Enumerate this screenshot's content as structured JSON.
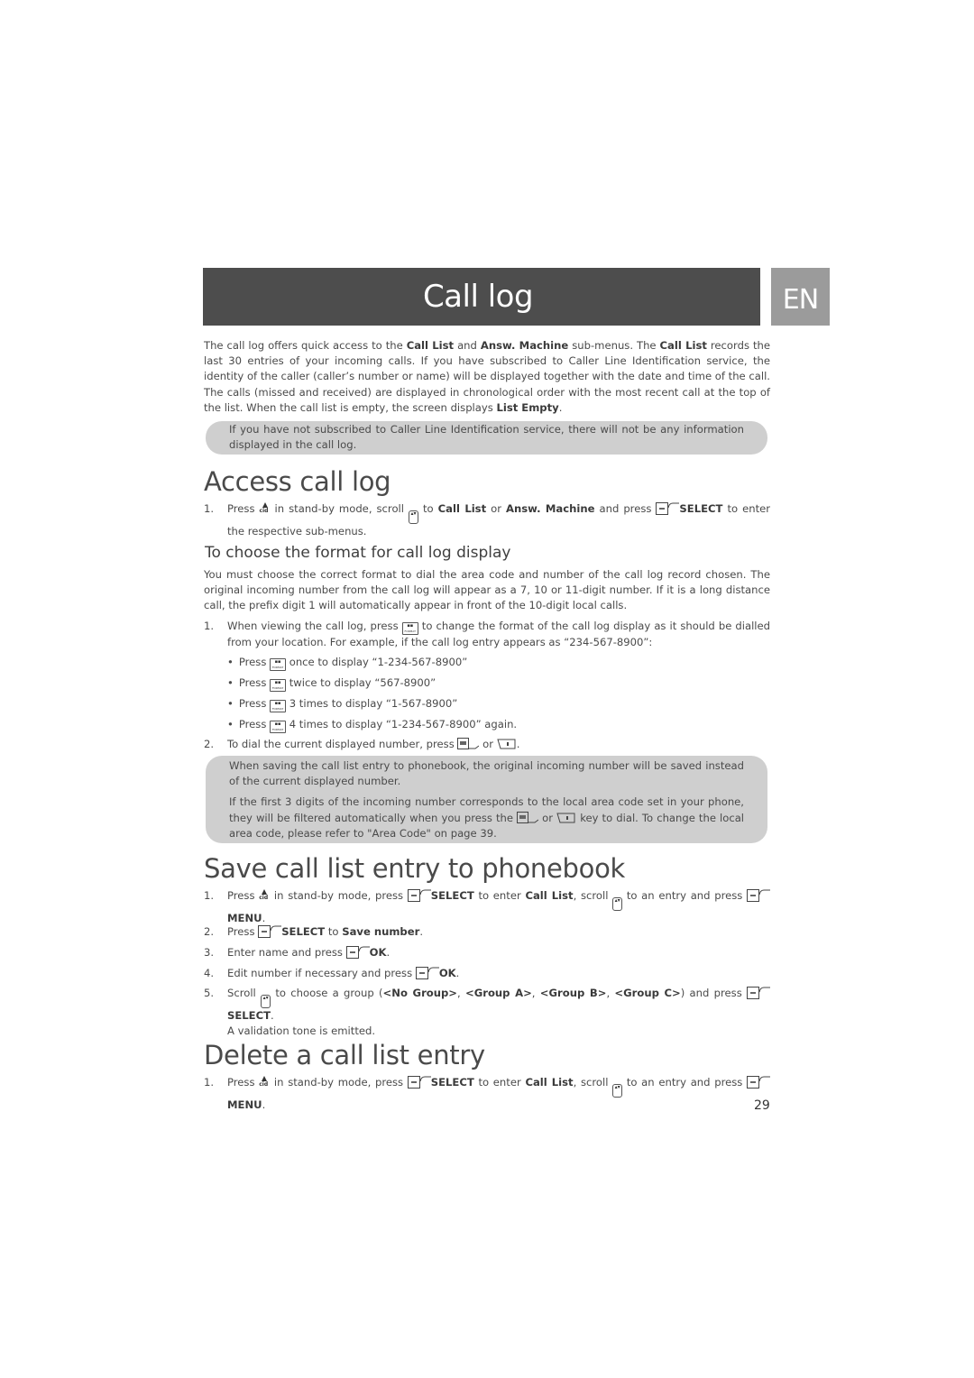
{
  "header": {
    "title": "Call log",
    "language": "EN"
  },
  "intro": {
    "parts": [
      {
        "t": "The call log offers quick access to the "
      },
      {
        "b": "Call List"
      },
      {
        "t": " and "
      },
      {
        "b": "Answ. Machine"
      },
      {
        "t": " sub-menus. The "
      },
      {
        "b": "Call List"
      },
      {
        "t": " records the last 30 entries of your incoming calls. If you have subscribed to Caller Line Identification service, the identity of the caller (caller’s number or name) will be displayed together with the date and time of the call. The calls (missed and received) are displayed in chronological order with the most recent call at the top of the list. When the call list is empty, the screen displays "
      },
      {
        "b": "List Empty"
      },
      {
        "t": "."
      }
    ]
  },
  "note1": {
    "text": "If you have not subscribed to Caller Line Identification service, there will not be any information displayed in the call log."
  },
  "access": {
    "heading": "Access call log",
    "step1": {
      "num": "1.",
      "t1": "Press",
      "t2": "in stand-by mode, scroll",
      "t3": "to",
      "b1": "Call List",
      "t4": "or",
      "b2": "Answ. Machine",
      "t5": "and press",
      "b3": "SELECT",
      "t6": "to enter the respective sub-menus."
    }
  },
  "format": {
    "heading": "To choose the format for call log display",
    "paragraph": "You must choose the correct format to dial the area code and number of the call log record chosen. The original incoming number from the call log will appear as a 7, 10 or 11-digit number. If it is a long distance call, the prefix digit 1 will automatically appear in front of the 10-digit local calls.",
    "step1": {
      "num": "1.",
      "t1": "When viewing the call log, press",
      "t2": "to change the format of the call log display as it should be dialled from your location. For example, if the call log entry appears as “234-567-8900”:"
    },
    "bullets": [
      {
        "press": "Press",
        "rest": "once to display “1-234-567-8900”"
      },
      {
        "press": "Press",
        "rest": "twice to display “567-8900”"
      },
      {
        "press": "Press",
        "rest": "3 times to display “1-567-8900”"
      },
      {
        "press": "Press",
        "rest": "4 times to display “1-234-567-8900” again."
      }
    ],
    "step2": {
      "num": "2.",
      "t1": "To dial the current displayed number, press",
      "t2": "or",
      "t3": "."
    }
  },
  "note2": {
    "p1": "When saving the call list entry to phonebook, the original incoming number will be saved instead of the current displayed number.",
    "p2a": "If the first 3 digits of the incoming number corresponds to the local area code set in your phone, they will be filtered automatically when you press the",
    "p2b": "or",
    "p2c": "key to dial. To change the local area code, please refer to \"Area Code\" on page 39."
  },
  "save": {
    "heading": "Save call list entry to phonebook",
    "steps": [
      {
        "num": "1.",
        "t1": "Press",
        "t2": "in stand-by mode, press",
        "b1": "SELECT",
        "t3": "to enter",
        "b2": "Call List",
        "t4": ", scroll",
        "t5": "to an entry and press",
        "b3": "MENU",
        "t6": "."
      },
      {
        "num": "2.",
        "t1": "Press",
        "b1": "SELECT",
        "t2": "to",
        "b2": "Save number",
        "t3": "."
      },
      {
        "num": "3.",
        "t1": "Enter name and press",
        "b1": "OK",
        "t2": "."
      },
      {
        "num": "4.",
        "t1": "Edit number if necessary and press",
        "b1": "OK",
        "t2": "."
      },
      {
        "num": "5.",
        "t1": "Scroll",
        "t2": "to choose a group (",
        "g1": "<No Group>",
        "g2": "<Group A>",
        "g3": "<Group B>",
        "g4": "<Group C>",
        "t3": ") and press",
        "b1": "SELECT",
        "t4": ".",
        "t5": "A validation tone is emitted."
      }
    ]
  },
  "delete": {
    "heading": "Delete a call list entry",
    "step1": {
      "num": "1.",
      "t1": "Press",
      "t2": "in stand-by mode, press",
      "b1": "SELECT",
      "t3": "to enter",
      "b2": "Call List",
      "t4": ", scroll",
      "t5": "to an entry and press",
      "b3": "MENU",
      "t6": "."
    }
  },
  "icons": {
    "cid_label": "cid",
    "scroll_glyph": "▴▾",
    "format_label": "FORMAT"
  },
  "page_number": "29"
}
